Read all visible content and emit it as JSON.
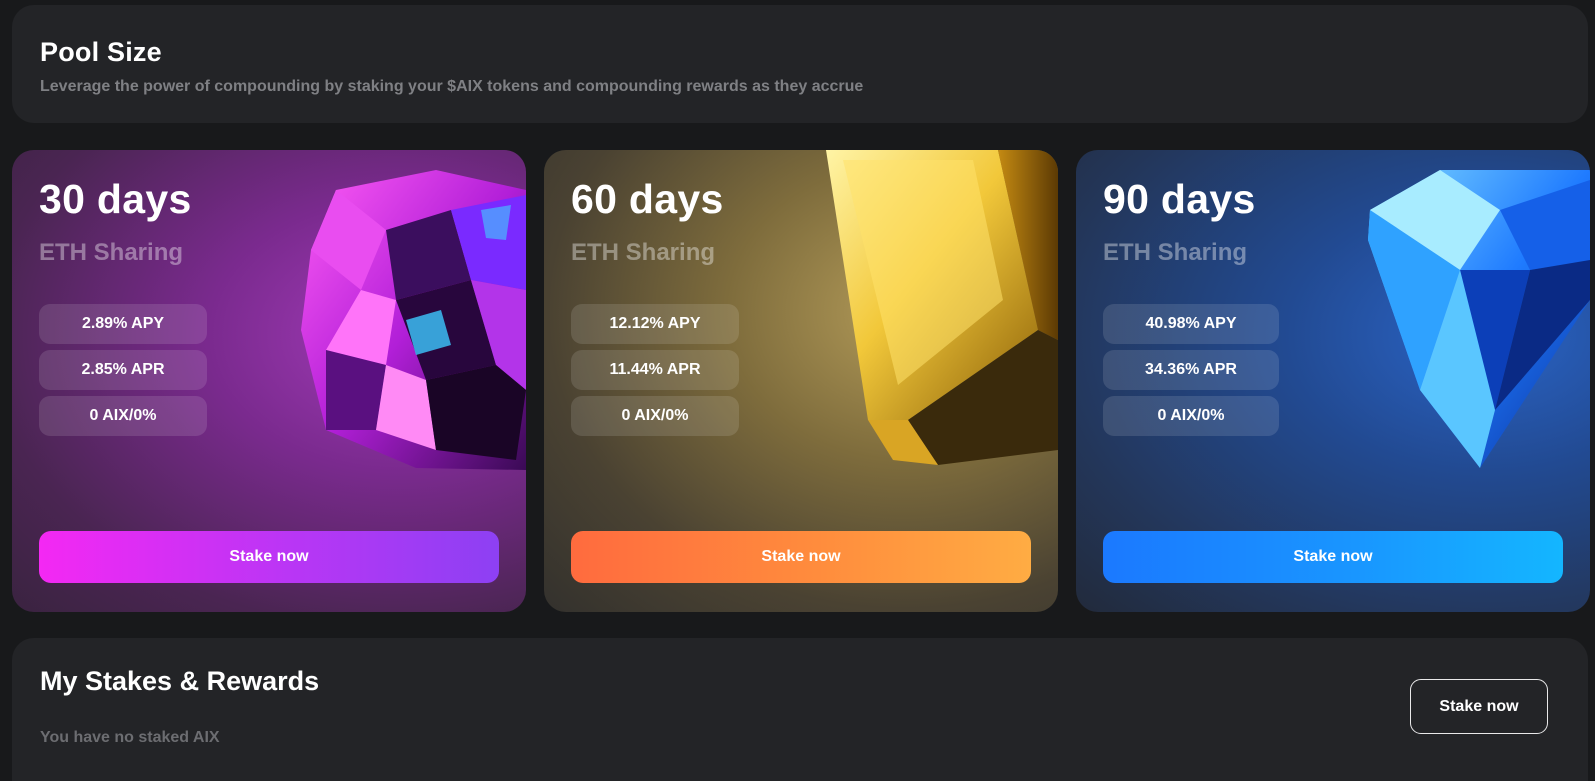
{
  "pool": {
    "title": "Pool Size",
    "subtitle": "Leverage the power of compounding by staking your $AIX tokens and compounding rewards as they accrue"
  },
  "cards": [
    {
      "days": "30 days",
      "sharing": "ETH Sharing",
      "apy": "2.89% APY",
      "apr": "2.85% APR",
      "staked": "0 AIX/0%",
      "button": "Stake now",
      "art_icon": "purple-crystal-icon",
      "accent": "#f428f3"
    },
    {
      "days": "60 days",
      "sharing": "ETH Sharing",
      "apy": "12.12% APY",
      "apr": "11.44% APR",
      "staked": "0 AIX/0%",
      "button": "Stake now",
      "art_icon": "gold-bar-icon",
      "accent": "#ff8d3d"
    },
    {
      "days": "90 days",
      "sharing": "ETH Sharing",
      "apy": "40.98% APY",
      "apr": "34.36% APR",
      "staked": "0 AIX/0%",
      "button": "Stake now",
      "art_icon": "blue-diamond-icon",
      "accent": "#1996ff"
    }
  ],
  "stakes": {
    "title": "My Stakes & Rewards",
    "empty": "You have no staked AIX",
    "button": "Stake now"
  }
}
